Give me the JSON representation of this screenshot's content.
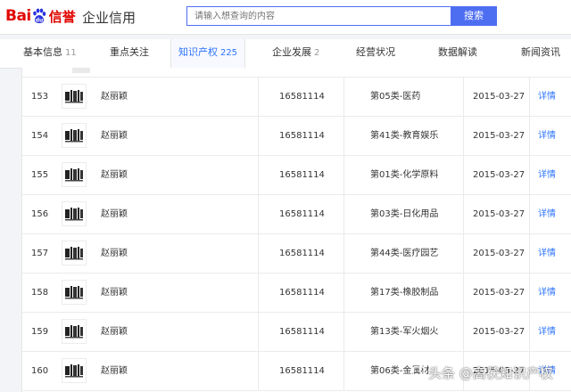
{
  "header": {
    "logo_text": "Baidu信誉",
    "brand_subtitle": "企业信用",
    "search_placeholder": "请输入想查询的内容",
    "search_button": "搜索",
    "accent_color": "#4e6ef2",
    "logo_red": "#e10601"
  },
  "tabs": [
    {
      "label": "基本信息",
      "count": "11"
    },
    {
      "label": "重点关注",
      "count": ""
    },
    {
      "label": "知识产权",
      "count": "225",
      "active": true
    },
    {
      "label": "企业发展",
      "count": "2"
    },
    {
      "label": "经营状况",
      "count": ""
    },
    {
      "label": "数据解读",
      "count": ""
    },
    {
      "label": "新闻资讯",
      "count": ""
    }
  ],
  "trademarks": [
    {
      "index": "153",
      "name": "赵丽颖",
      "reg_no": "16581114",
      "class": "第05类-医药",
      "date": "2015-03-27",
      "action": "详情"
    },
    {
      "index": "154",
      "name": "赵丽颖",
      "reg_no": "16581114",
      "class": "第41类-教育娱乐",
      "date": "2015-03-27",
      "action": "详情"
    },
    {
      "index": "155",
      "name": "赵丽颖",
      "reg_no": "16581114",
      "class": "第01类-化学原料",
      "date": "2015-03-27",
      "action": "详情"
    },
    {
      "index": "156",
      "name": "赵丽颖",
      "reg_no": "16581114",
      "class": "第03类-日化用品",
      "date": "2015-03-27",
      "action": "详情"
    },
    {
      "index": "157",
      "name": "赵丽颖",
      "reg_no": "16581114",
      "class": "第44类-医疗园艺",
      "date": "2015-03-27",
      "action": "详情"
    },
    {
      "index": "158",
      "name": "赵丽颖",
      "reg_no": "16581114",
      "class": "第17类-橡胶制品",
      "date": "2015-03-27",
      "action": "详情"
    },
    {
      "index": "159",
      "name": "赵丽颖",
      "reg_no": "16581114",
      "class": "第13类-军火烟火",
      "date": "2015-03-27",
      "action": "详情"
    },
    {
      "index": "160",
      "name": "赵丽颖",
      "reg_no": "16581114",
      "class": "第06类-金属材",
      "date": "2015-03-27",
      "action": "详情"
    }
  ],
  "watermark": "头条 @高茯知识产权"
}
